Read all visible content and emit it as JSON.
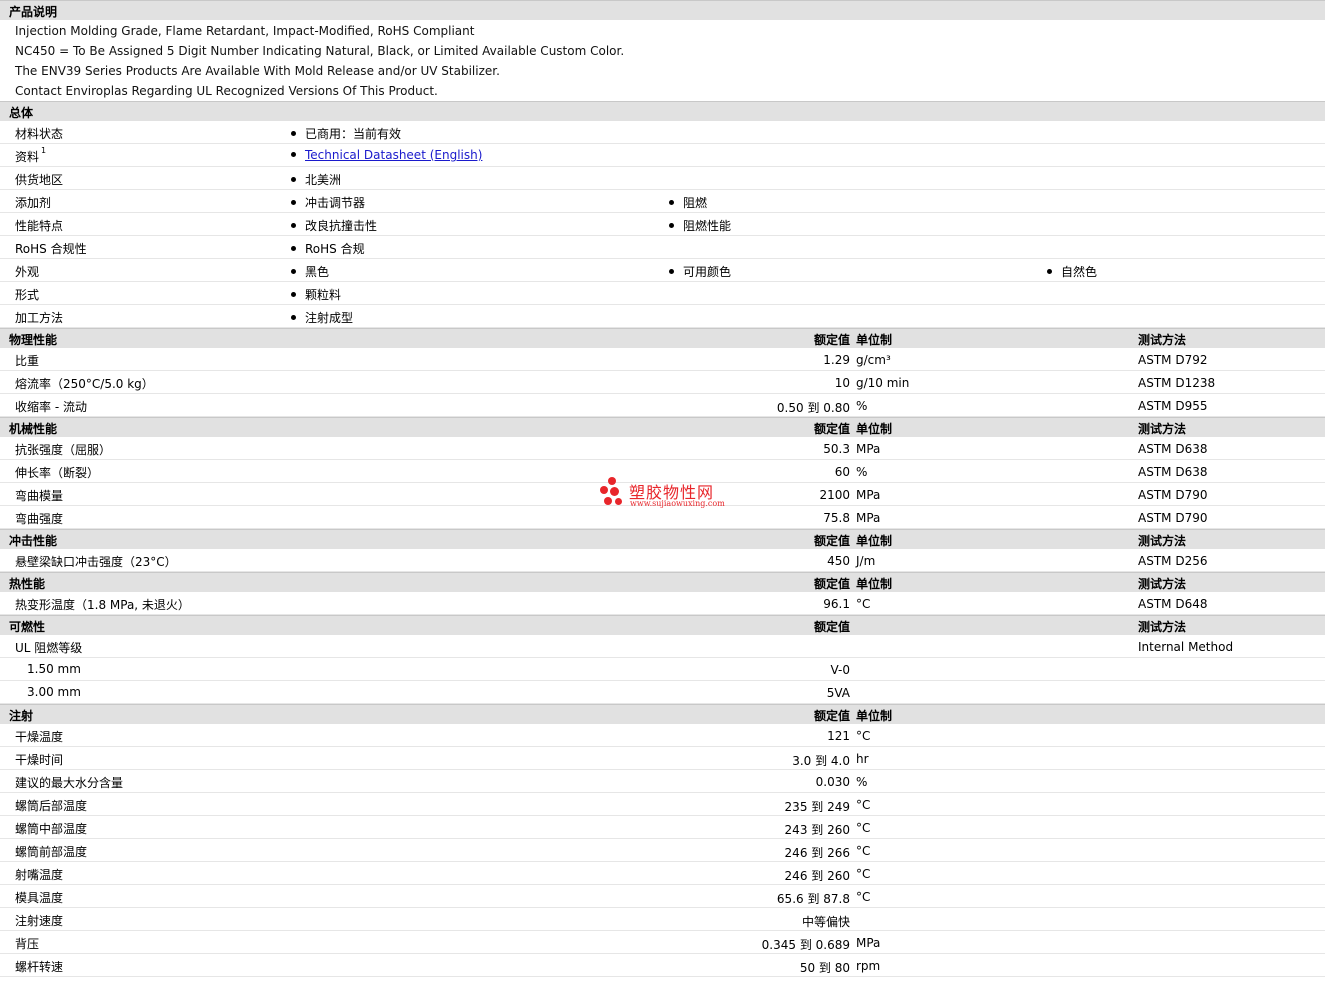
{
  "product": {
    "title": "产品说明",
    "lines": [
      "Injection Molding Grade, Flame Retardant, Impact-Modified, RoHS Compliant",
      "NC450 = To Be Assigned 5 Digit Number Indicating Natural, Black, or Limited Available Custom Color.",
      "The ENV39 Series Products Are Available With Mold Release and/or UV Stabilizer.",
      "Contact Enviroplas Regarding UL Recognized Versions Of This Product."
    ]
  },
  "general": {
    "title": "总体",
    "rows": [
      {
        "label": "材料状态",
        "sup": "",
        "items": [
          "已商用：当前有效"
        ]
      },
      {
        "label": "资料",
        "sup": "1",
        "items": [
          "Technical Datasheet (English)"
        ],
        "link": true
      },
      {
        "label": "供货地区",
        "sup": "",
        "items": [
          "北美洲"
        ]
      },
      {
        "label": "添加剂",
        "sup": "",
        "items": [
          "冲击调节器",
          "阻燃"
        ]
      },
      {
        "label": "性能特点",
        "sup": "",
        "items": [
          "改良抗撞击性",
          "阻燃性能"
        ]
      },
      {
        "label": "RoHS 合规性",
        "sup": "",
        "items": [
          "RoHS 合规"
        ]
      },
      {
        "label": "外观",
        "sup": "",
        "items": [
          "黑色",
          "可用颜色",
          "自然色"
        ]
      },
      {
        "label": "形式",
        "sup": "",
        "items": [
          "颗粒料"
        ]
      },
      {
        "label": "加工方法",
        "sup": "",
        "items": [
          "注射成型"
        ]
      }
    ]
  },
  "sections": [
    {
      "title": "物理性能",
      "c_val": "额定值",
      "c_unit": "单位制",
      "c_test": "测试方法",
      "rows": [
        {
          "label": "比重",
          "value": "1.29",
          "unit": "g/cm³",
          "test": "ASTM D792"
        },
        {
          "label": "熔流率（250°C/5.0 kg）",
          "value": "10",
          "unit": "g/10 min",
          "test": "ASTM D1238"
        },
        {
          "label": "收缩率 - 流动",
          "value": "0.50 到  0.80",
          "unit": "%",
          "test": "ASTM D955"
        }
      ]
    },
    {
      "title": "机械性能",
      "c_val": "额定值",
      "c_unit": "单位制",
      "c_test": "测试方法",
      "rows": [
        {
          "label": "抗张强度（屈服）",
          "value": "50.3",
          "unit": "MPa",
          "test": "ASTM D638"
        },
        {
          "label": "伸长率（断裂）",
          "value": "60",
          "unit": "%",
          "test": "ASTM D638"
        },
        {
          "label": "弯曲模量",
          "value": "2100",
          "unit": "MPa",
          "test": "ASTM D790"
        },
        {
          "label": "弯曲强度",
          "value": "75.8",
          "unit": "MPa",
          "test": "ASTM D790"
        }
      ]
    },
    {
      "title": "冲击性能",
      "c_val": "额定值",
      "c_unit": "单位制",
      "c_test": "测试方法",
      "rows": [
        {
          "label": "悬壁梁缺口冲击强度（23°C）",
          "value": "450",
          "unit": "J/m",
          "test": "ASTM D256"
        }
      ]
    },
    {
      "title": "热性能",
      "c_val": "额定值",
      "c_unit": "单位制",
      "c_test": "测试方法",
      "rows": [
        {
          "label": "热变形温度（1.8 MPa, 未退火）",
          "value": "96.1",
          "unit": "°C",
          "test": "ASTM D648"
        }
      ]
    },
    {
      "title": "可燃性",
      "c_val": "额定值",
      "c_unit": "",
      "c_test": "测试方法",
      "rows": [
        {
          "label": "UL 阻燃等级",
          "value": "",
          "unit": "",
          "test": "Internal Method"
        },
        {
          "label": "1.50 mm",
          "value": "V-0",
          "unit": "",
          "test": "",
          "indent": true
        },
        {
          "label": "3.00 mm",
          "value": "5VA",
          "unit": "",
          "test": "",
          "indent": true
        }
      ]
    },
    {
      "title": "注射",
      "c_val": "额定值",
      "c_unit": "单位制",
      "c_test": "",
      "rows": [
        {
          "label": "干燥温度",
          "value": "121",
          "unit": "°C",
          "test": ""
        },
        {
          "label": "干燥时间",
          "value": "3.0 到  4.0",
          "unit": "hr",
          "test": ""
        },
        {
          "label": "建议的最大水分含量",
          "value": "0.030",
          "unit": "%",
          "test": ""
        },
        {
          "label": "螺筒后部温度",
          "value": "235 到  249",
          "unit": "°C",
          "test": ""
        },
        {
          "label": "螺筒中部温度",
          "value": "243 到  260",
          "unit": "°C",
          "test": ""
        },
        {
          "label": "螺筒前部温度",
          "value": "246 到  266",
          "unit": "°C",
          "test": ""
        },
        {
          "label": "射嘴温度",
          "value": "246 到  260",
          "unit": "°C",
          "test": ""
        },
        {
          "label": "模具温度",
          "value": "65.6 到  87.8",
          "unit": "°C",
          "test": ""
        },
        {
          "label": "注射速度",
          "value": "中等偏快",
          "unit": "",
          "test": ""
        },
        {
          "label": "背压",
          "value": "0.345 到  0.689",
          "unit": "MPa",
          "test": ""
        },
        {
          "label": "螺杆转速",
          "value": "50 到  80",
          "unit": "rpm",
          "test": ""
        }
      ]
    }
  ],
  "watermark": {
    "brand": "塑胶物性网",
    "url": "www.sujiaowuxing.com",
    "color": "#e8262b"
  }
}
